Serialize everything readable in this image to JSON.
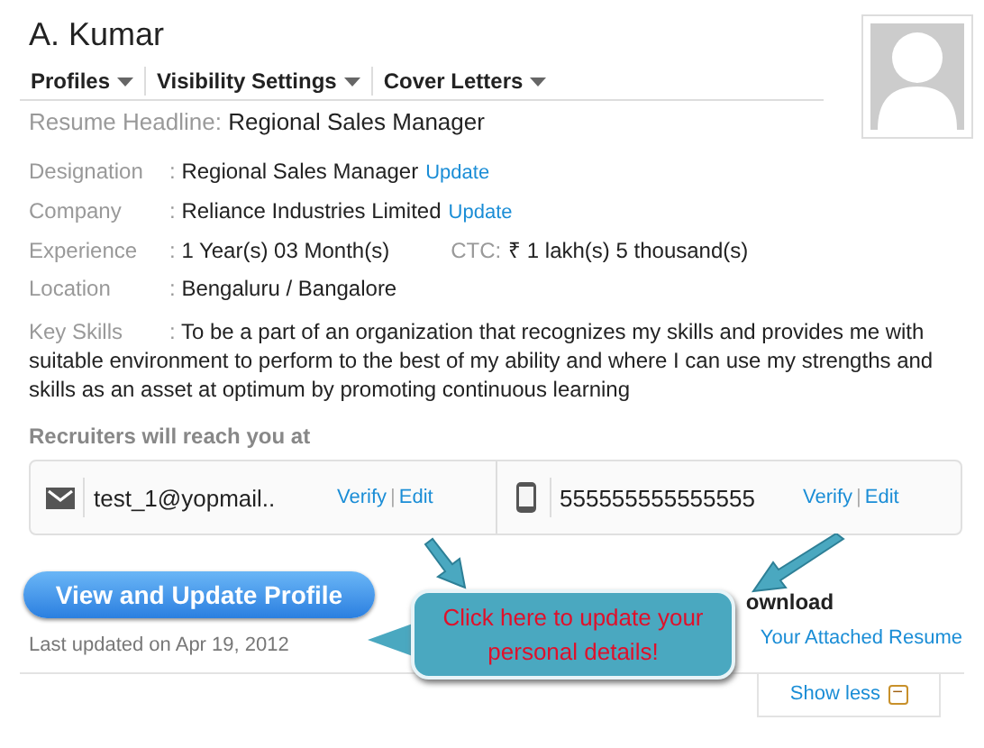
{
  "name": "A. Kumar",
  "menus": [
    {
      "label": "Profiles"
    },
    {
      "label": "Visibility Settings"
    },
    {
      "label": "Cover Letters"
    }
  ],
  "headline": {
    "label": "Resume Headline:",
    "value": "Regional Sales Manager"
  },
  "details": [
    {
      "label": "Designation",
      "separator": ":",
      "value": "Regional Sales Manager",
      "link": "Update"
    },
    {
      "label": "Company",
      "separator": ":",
      "value": "Reliance Industries Limited",
      "link": "Update"
    },
    {
      "label": "Experience",
      "separator": ":",
      "value": "1 Year(s) 03 Month(s)",
      "extra_label": "CTC:",
      "extra_value": "₹ 1 lakh(s) 5 thousand(s)"
    },
    {
      "label": "Location",
      "separator": ":",
      "value": "Bengaluru / Bangalore"
    }
  ],
  "key_skills": {
    "label": "Key Skills",
    "separator": ":",
    "value": "To be a part of an organization that recognizes my skills and provides me with suitable environment to perform to the best of my ability and where I can use my strengths and skills as an asset at optimum by promoting continuous learning"
  },
  "contacts_title": "Recruiters will reach you at",
  "contacts": [
    {
      "kind": "email",
      "value": "test_1@yopmail..",
      "verify": "Verify",
      "separator": "|",
      "edit": "Edit"
    },
    {
      "kind": "phone",
      "value": "555555555555555",
      "verify": "Verify",
      "separator": "|",
      "edit": "Edit"
    }
  ],
  "primary_button": "View and Update Profile",
  "last_updated": "Last updated on Apr 19, 2012",
  "download": {
    "title": "ownload",
    "link": "Your Attached Resume"
  },
  "callout": "Click here to update your personal details!",
  "show_less": {
    "label": "Show less",
    "icon": "−"
  }
}
